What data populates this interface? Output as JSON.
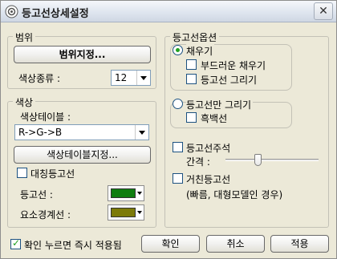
{
  "window": {
    "title": "등고선상세설정",
    "close_label": "✕"
  },
  "range_group": {
    "label": "범위",
    "range_button": "범위지정...",
    "color_type_label": "색상종류 :",
    "color_type_value": "12"
  },
  "color_group": {
    "label": "색상",
    "color_table_label": "색상테이블 :",
    "color_table_value": "R->G->B",
    "color_table_button": "색상테이블지정...",
    "symmetric_label": "대칭등고선",
    "symmetric_checked": false,
    "contour_line_label": "등고선 :",
    "contour_line_color": "#0f7e10",
    "element_boundary_label": "요소경계선 :",
    "element_boundary_color": "#7c7a09"
  },
  "contour_options": {
    "label": "등고선옵션",
    "fill_label": "채우기",
    "fill_selected": true,
    "smooth_fill_label": "부드러운 채우기",
    "smooth_fill_checked": false,
    "draw_contour_label": "등고선 그리기",
    "draw_contour_checked": false,
    "contour_only_label": "등고선만 그리기",
    "contour_only_selected": false,
    "monochrome_label": "흑백선",
    "monochrome_checked": false
  },
  "annotation": {
    "label": "등고선주석",
    "checked": false,
    "interval_label": "간격 :",
    "interval_level": 0.12
  },
  "coarse": {
    "label": "거친등고선",
    "checked": false,
    "note": "(빠름, 대형모델인 경우)"
  },
  "footer": {
    "apply_immediately_label": "확인 누르면 즉시 적용됨",
    "apply_immediately_checked": true,
    "ok_label": "확인",
    "cancel_label": "취소",
    "apply_label": "적용"
  }
}
